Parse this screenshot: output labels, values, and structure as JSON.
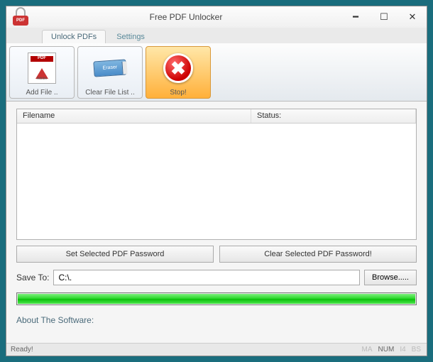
{
  "window": {
    "title": "Free PDF Unlocker"
  },
  "tabs": {
    "unlock": "Unlock PDFs",
    "settings": "Settings"
  },
  "toolbar": {
    "add_file": "Add File ..",
    "clear_list": "Clear File List ..",
    "stop": "Stop!"
  },
  "listview": {
    "col_filename": "Filename",
    "col_status": "Status:"
  },
  "buttons": {
    "set_password": "Set Selected PDF Password",
    "clear_password": "Clear Selected PDF Password!",
    "browse": "Browse....."
  },
  "save": {
    "label": "Save To:",
    "value": "C:\\."
  },
  "about": "About The Software:",
  "statusbar": {
    "ready": "Ready!",
    "ma": "MA",
    "num": "NUM",
    "i4": "I4",
    "bs": "BS"
  }
}
